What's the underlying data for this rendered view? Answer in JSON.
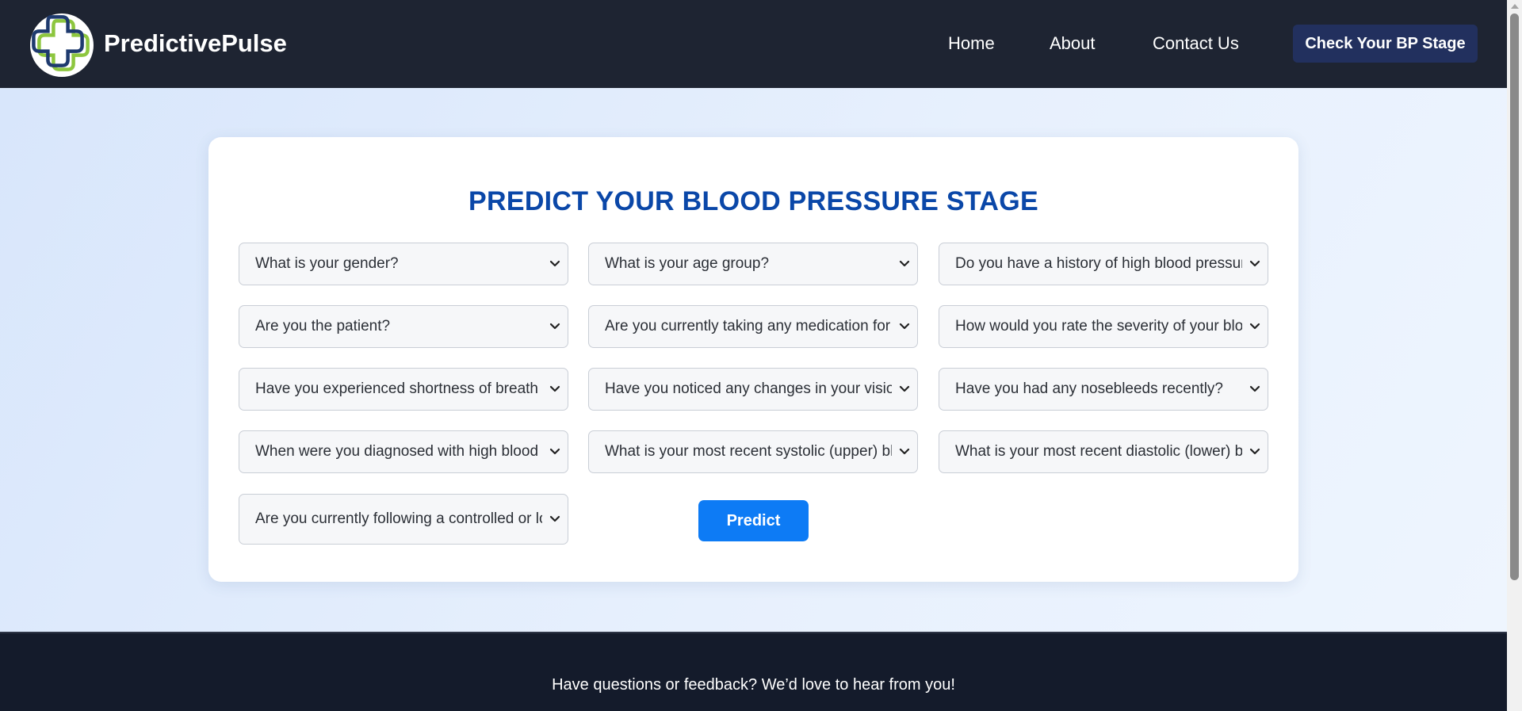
{
  "brand": {
    "name": "PredictivePulse",
    "logo_icon": "medical-cross-icon",
    "colors": {
      "navy": "#1e3a6e",
      "green": "#8dc63f"
    }
  },
  "nav": {
    "links": [
      "Home",
      "About",
      "Contact Us"
    ],
    "cta_label": "Check Your BP Stage"
  },
  "form": {
    "title": "PREDICT YOUR BLOOD PRESSURE STAGE",
    "selects": [
      "What is your gender?",
      "What is your age group?",
      "Do you have a history of high blood pressure?",
      "Are you the patient?",
      "Are you currently taking any medication for high blood pressure?",
      "How would you rate the severity of your blood pressure symptoms?",
      "Have you experienced shortness of breath recently?",
      "Have you noticed any changes in your vision?",
      "Have you had any nosebleeds recently?",
      "When were you diagnosed with high blood pressure?",
      "What is your most recent systolic (upper) blood pressure reading?",
      "What is your most recent diastolic (lower) blood pressure reading?",
      "Are you currently following a controlled or low-salt diet?"
    ],
    "submit_label": "Predict"
  },
  "footer": {
    "text": "Have questions or feedback? We’d love to hear from you!"
  },
  "colors": {
    "nav_bg": "#1e2432",
    "cta_bg": "#22305e",
    "title": "#0a47a8",
    "predict_bg": "#0d7bf5",
    "footer_bg": "#141b2b"
  }
}
